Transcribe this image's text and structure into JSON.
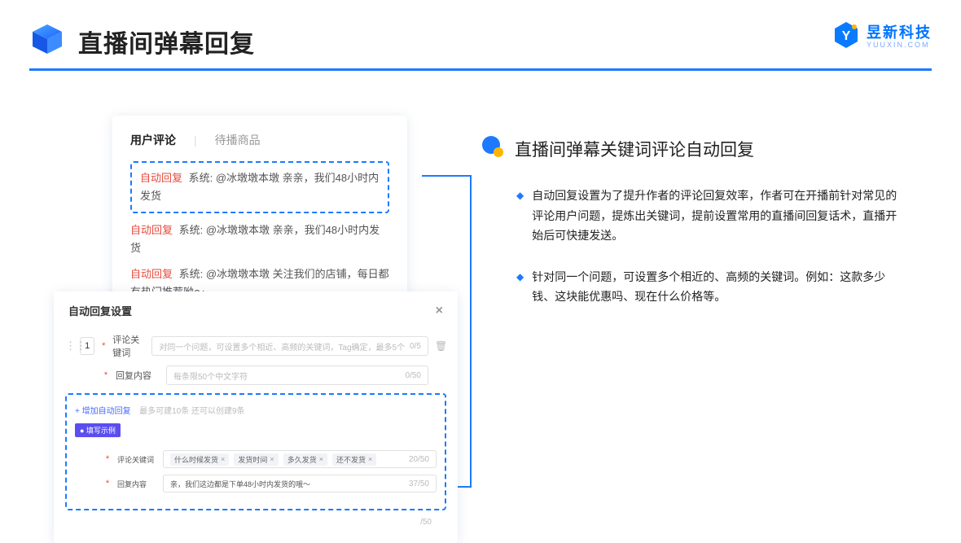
{
  "header": {
    "title": "直播间弹幕回复",
    "brand_cn": "昱新科技",
    "brand_en": "YUUXIN.COM"
  },
  "comments_card": {
    "tab_active": "用户评论",
    "tab_other": "待播商品",
    "highlighted": {
      "tag": "自动回复",
      "text": "系统: @冰墩墩本墩 亲亲，我们48小时内发货"
    },
    "line2": {
      "tag": "自动回复",
      "text": "系统: @冰墩墩本墩 亲亲，我们48小时内发货"
    },
    "line3": {
      "tag": "自动回复",
      "text": "系统: @冰墩墩本墩 关注我们的店铺，每日都有热门推荐呦～"
    }
  },
  "settings_card": {
    "title": "自动回复设置",
    "index": "1",
    "kw_label": "评论关键词",
    "kw_placeholder": "对同一个问题，可设置多个相近、高频的关键词，Tag确定，最多5个",
    "kw_count": "0/5",
    "content_label": "回复内容",
    "content_placeholder": "每条限50个中文字符",
    "content_count": "0/50",
    "add_text": "+ 增加自动回复",
    "add_hint": "最多可建10条 还可以创建9条",
    "example_badge": "● 填写示例",
    "ex_kw_label": "评论关键词",
    "ex_tags": [
      "什么时候发货",
      "发货时间",
      "多久发货",
      "还不发货"
    ],
    "ex_kw_count": "20/50",
    "ex_content_label": "回复内容",
    "ex_content_value": "亲，我们这边都是下单48小时内发货的哦～",
    "ex_content_count": "37/50",
    "outer_count": "/50"
  },
  "right": {
    "title": "直播间弹幕关键词评论自动回复",
    "b1": "自动回复设置为了提升作者的评论回复效率，作者可在开播前针对常见的评论用户问题，提炼出关键词，提前设置常用的直播间回复话术，直播开始后可快捷发送。",
    "b2": "针对同一个问题，可设置多个相近的、高频的关键词。例如：这款多少钱、这块能优惠吗、现在什么价格等。"
  }
}
